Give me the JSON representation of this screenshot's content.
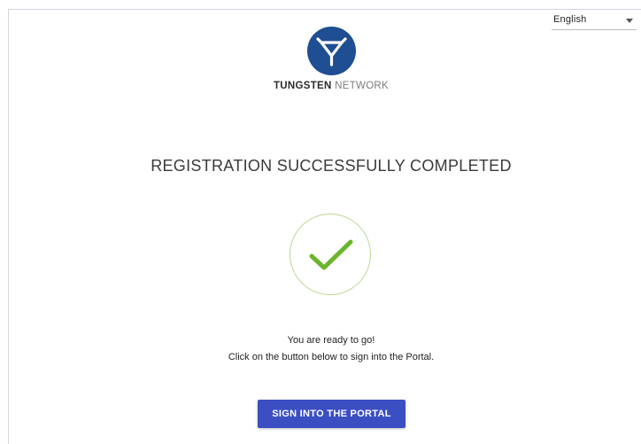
{
  "language": {
    "selected": "English",
    "icon": "chevron-down-icon"
  },
  "brand": {
    "icon": "tungsten-logo-icon",
    "name_bold": "TUNGSTEN",
    "name_light": " NETWORK",
    "color": "#1f4e92"
  },
  "main": {
    "title": "REGISTRATION SUCCESSFULLY COMPLETED",
    "status_icon": "checkmark-icon",
    "status_color": "#6bb52a",
    "message_line1": "You are ready to go!",
    "message_line2": "Click on the button below to sign into the Portal.",
    "cta_label": "SIGN INTO THE PORTAL",
    "cta_color": "#3b4ec2"
  }
}
